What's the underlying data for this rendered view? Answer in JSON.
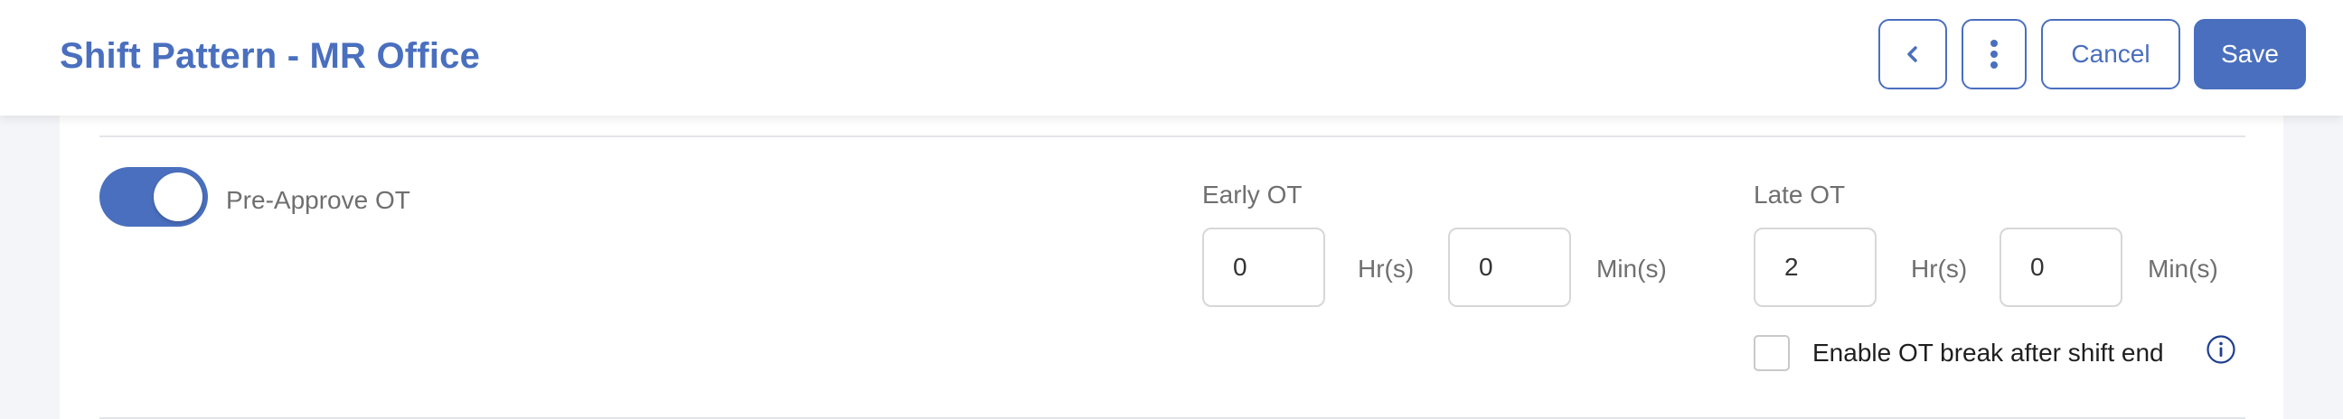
{
  "header": {
    "title": "Shift Pattern - MR Office",
    "back_icon": "chevron-left-icon",
    "more_icon": "kebab-menu-icon",
    "cancel_label": "Cancel",
    "save_label": "Save"
  },
  "colors": {
    "accent": "#4a6fbe",
    "background": "#f4f5f9",
    "muted_text": "#6f6f6f",
    "border": "#d7d7d7"
  },
  "pre_approve": {
    "label": "Pre-Approve OT",
    "enabled": true
  },
  "early_ot": {
    "label": "Early OT",
    "hours_value": "0",
    "hours_unit": "Hr(s)",
    "minutes_value": "0",
    "minutes_unit": "Min(s)"
  },
  "late_ot": {
    "label": "Late OT",
    "hours_value": "2",
    "hours_unit": "Hr(s)",
    "minutes_value": "0",
    "minutes_unit": "Min(s)",
    "break_checkbox": {
      "label": "Enable OT break after shift end",
      "checked": false,
      "info_icon": "info-icon"
    }
  }
}
